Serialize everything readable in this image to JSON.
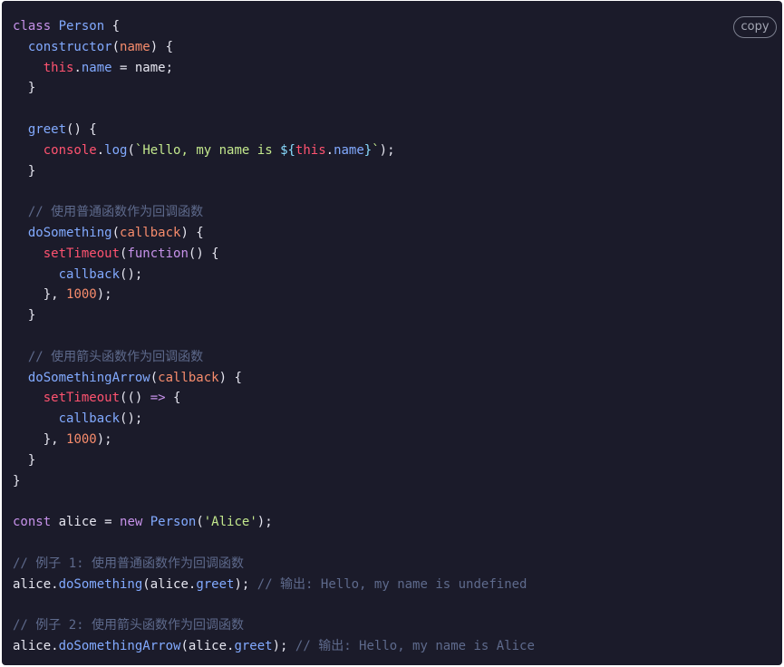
{
  "copy_button": {
    "label": "copy"
  },
  "colors": {
    "background": "#1b1b2a",
    "keyword": "#c792ea",
    "function": "#82aaff",
    "parameter": "#f78c6c",
    "this": "#ff5370",
    "string": "#c3e88d",
    "number": "#f78c6c",
    "comment": "#5e6a8c",
    "plain": "#e6e6f0"
  },
  "code": {
    "language": "javascript",
    "lines": [
      [
        {
          "t": "class ",
          "c": "keyword"
        },
        {
          "t": "Person",
          "c": "class"
        },
        {
          "t": " {",
          "c": "plain"
        }
      ],
      [
        {
          "t": "  ",
          "c": "plain"
        },
        {
          "t": "constructor",
          "c": "func"
        },
        {
          "t": "(",
          "c": "plain"
        },
        {
          "t": "name",
          "c": "param"
        },
        {
          "t": ") {",
          "c": "plain"
        }
      ],
      [
        {
          "t": "    ",
          "c": "plain"
        },
        {
          "t": "this",
          "c": "this"
        },
        {
          "t": ".",
          "c": "plain"
        },
        {
          "t": "name",
          "c": "prop"
        },
        {
          "t": " = name;",
          "c": "plain"
        }
      ],
      [
        {
          "t": "  }",
          "c": "plain"
        }
      ],
      [],
      [
        {
          "t": "  ",
          "c": "plain"
        },
        {
          "t": "greet",
          "c": "func"
        },
        {
          "t": "() {",
          "c": "plain"
        }
      ],
      [
        {
          "t": "    ",
          "c": "plain"
        },
        {
          "t": "console",
          "c": "builtin"
        },
        {
          "t": ".",
          "c": "plain"
        },
        {
          "t": "log",
          "c": "method"
        },
        {
          "t": "(",
          "c": "plain"
        },
        {
          "t": "`Hello, my name is ",
          "c": "string"
        },
        {
          "t": "${",
          "c": "interp"
        },
        {
          "t": "this",
          "c": "this"
        },
        {
          "t": ".",
          "c": "plain"
        },
        {
          "t": "name",
          "c": "prop"
        },
        {
          "t": "}",
          "c": "interp"
        },
        {
          "t": "`",
          "c": "string"
        },
        {
          "t": ");",
          "c": "plain"
        }
      ],
      [
        {
          "t": "  }",
          "c": "plain"
        }
      ],
      [],
      [
        {
          "t": "  // 使用普通函数作为回调函数",
          "c": "comment"
        }
      ],
      [
        {
          "t": "  ",
          "c": "plain"
        },
        {
          "t": "doSomething",
          "c": "func"
        },
        {
          "t": "(",
          "c": "plain"
        },
        {
          "t": "callback",
          "c": "param"
        },
        {
          "t": ") {",
          "c": "plain"
        }
      ],
      [
        {
          "t": "    ",
          "c": "plain"
        },
        {
          "t": "setTimeout",
          "c": "builtin"
        },
        {
          "t": "(",
          "c": "plain"
        },
        {
          "t": "function",
          "c": "keyword"
        },
        {
          "t": "() {",
          "c": "plain"
        }
      ],
      [
        {
          "t": "      ",
          "c": "plain"
        },
        {
          "t": "callback",
          "c": "func"
        },
        {
          "t": "();",
          "c": "plain"
        }
      ],
      [
        {
          "t": "    }, ",
          "c": "plain"
        },
        {
          "t": "1000",
          "c": "number"
        },
        {
          "t": ");",
          "c": "plain"
        }
      ],
      [
        {
          "t": "  }",
          "c": "plain"
        }
      ],
      [],
      [
        {
          "t": "  // 使用箭头函数作为回调函数",
          "c": "comment"
        }
      ],
      [
        {
          "t": "  ",
          "c": "plain"
        },
        {
          "t": "doSomethingArrow",
          "c": "func"
        },
        {
          "t": "(",
          "c": "plain"
        },
        {
          "t": "callback",
          "c": "param"
        },
        {
          "t": ") {",
          "c": "plain"
        }
      ],
      [
        {
          "t": "    ",
          "c": "plain"
        },
        {
          "t": "setTimeout",
          "c": "builtin"
        },
        {
          "t": "(() ",
          "c": "plain"
        },
        {
          "t": "=>",
          "c": "keyword"
        },
        {
          "t": " {",
          "c": "plain"
        }
      ],
      [
        {
          "t": "      ",
          "c": "plain"
        },
        {
          "t": "callback",
          "c": "func"
        },
        {
          "t": "();",
          "c": "plain"
        }
      ],
      [
        {
          "t": "    }, ",
          "c": "plain"
        },
        {
          "t": "1000",
          "c": "number"
        },
        {
          "t": ");",
          "c": "plain"
        }
      ],
      [
        {
          "t": "  }",
          "c": "plain"
        }
      ],
      [
        {
          "t": "}",
          "c": "plain"
        }
      ],
      [],
      [
        {
          "t": "const ",
          "c": "keyword"
        },
        {
          "t": "alice = ",
          "c": "plain"
        },
        {
          "t": "new ",
          "c": "keyword"
        },
        {
          "t": "Person",
          "c": "class"
        },
        {
          "t": "(",
          "c": "plain"
        },
        {
          "t": "'Alice'",
          "c": "string"
        },
        {
          "t": ");",
          "c": "plain"
        }
      ],
      [],
      [
        {
          "t": "// 例子 1: 使用普通函数作为回调函数",
          "c": "comment"
        }
      ],
      [
        {
          "t": "alice.",
          "c": "plain"
        },
        {
          "t": "doSomething",
          "c": "func"
        },
        {
          "t": "(alice.",
          "c": "plain"
        },
        {
          "t": "greet",
          "c": "prop"
        },
        {
          "t": "); ",
          "c": "plain"
        },
        {
          "t": "// 输出: Hello, my name is undefined",
          "c": "comment"
        }
      ],
      [],
      [
        {
          "t": "// 例子 2: 使用箭头函数作为回调函数",
          "c": "comment"
        }
      ],
      [
        {
          "t": "alice.",
          "c": "plain"
        },
        {
          "t": "doSomethingArrow",
          "c": "func"
        },
        {
          "t": "(alice.",
          "c": "plain"
        },
        {
          "t": "greet",
          "c": "prop"
        },
        {
          "t": "); ",
          "c": "plain"
        },
        {
          "t": "// 输出: Hello, my name is Alice",
          "c": "comment"
        }
      ]
    ]
  }
}
